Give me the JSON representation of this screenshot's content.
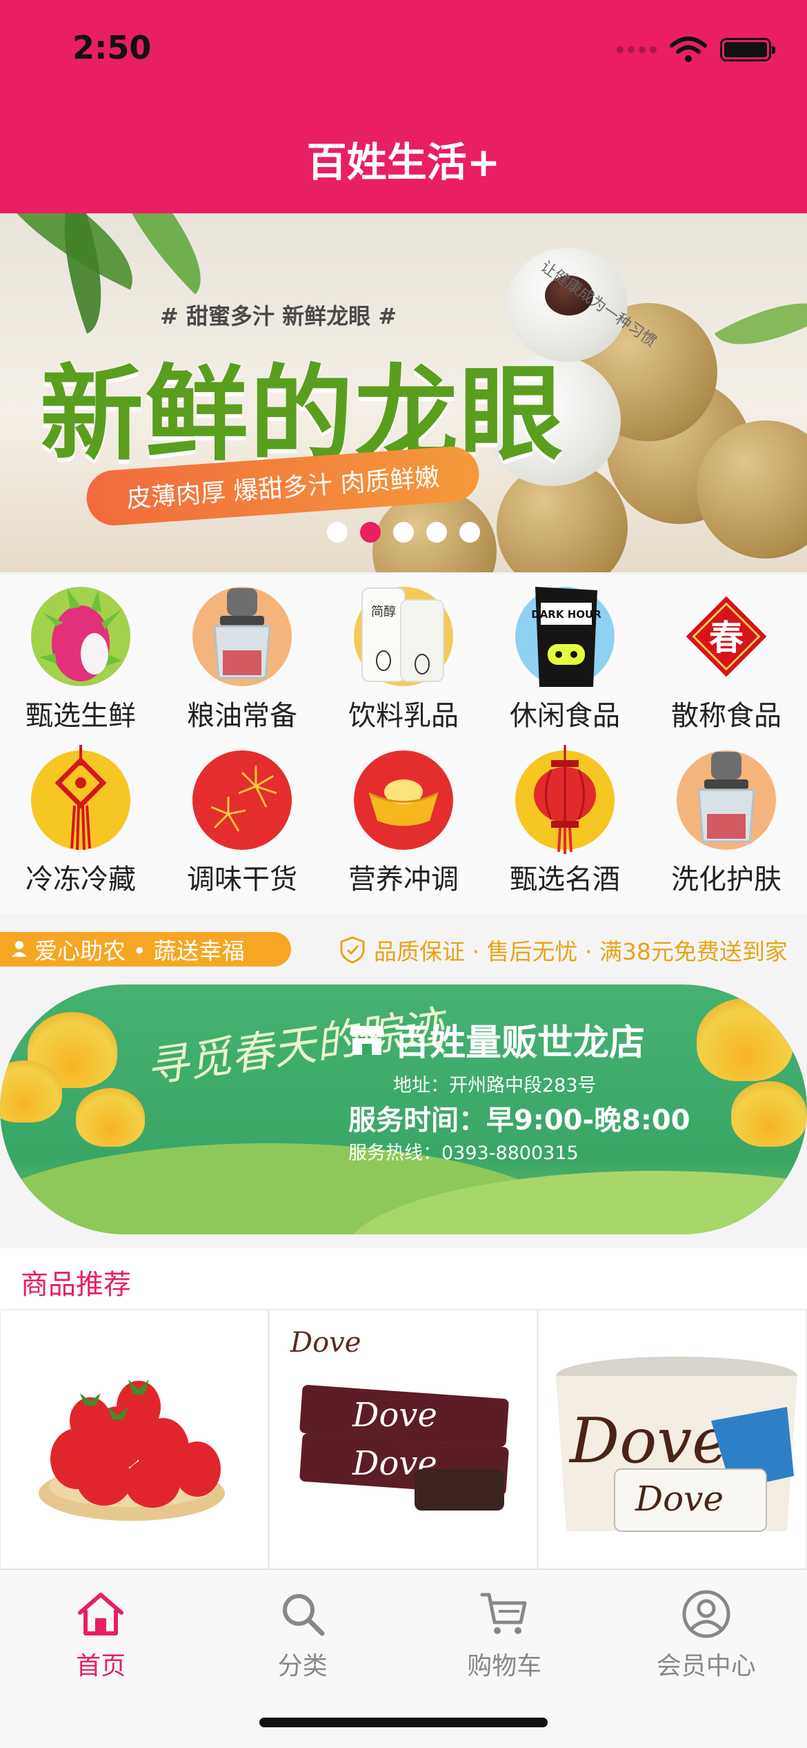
{
  "status_bar": {
    "time": "2:50"
  },
  "header": {
    "title": "百姓生活+"
  },
  "banner": {
    "tagline": "# 甜蜜多汁 新鲜龙眼 #",
    "side_text": "让健康成为一种习惯",
    "headline": "新鲜的龙眼",
    "pill": "皮薄肉厚 爆甜多汁 肉质鲜嫩",
    "slide_count": 5,
    "active_slide": 1
  },
  "categories": [
    {
      "label": "甄选生鲜",
      "icon": "dragonfruit-icon"
    },
    {
      "label": "粮油常备",
      "icon": "chopper-icon"
    },
    {
      "label": "饮料乳品",
      "icon": "milk-icon"
    },
    {
      "label": "休闲食品",
      "icon": "chips-icon"
    },
    {
      "label": "散称食品",
      "icon": "spring-icon"
    },
    {
      "label": "冷冻冷藏",
      "icon": "chinese-knot-icon"
    },
    {
      "label": "调味干货",
      "icon": "fireworks-icon"
    },
    {
      "label": "营养冲调",
      "icon": "gold-ingot-icon"
    },
    {
      "label": "甄选名酒",
      "icon": "lantern-icon"
    },
    {
      "label": "洗化护肤",
      "icon": "chopper-icon"
    }
  ],
  "notice": {
    "left": "爱心助农 • 蔬送幸福",
    "right": "品质保证 · 售后无忧 · 满38元免费送到家"
  },
  "store": {
    "slogan": "寻觅春天的踪迹",
    "name": "百姓量贩世龙店",
    "address": "地址：开州路中段283号",
    "hours": "服务时间：早9:00-晚8:00",
    "phone": "服务热线：0393-8800315"
  },
  "recommend": {
    "title": "商品推荐",
    "products": [
      {
        "name": "strawberries"
      },
      {
        "name": "dove-chocolate-bars",
        "brand": "Dove"
      },
      {
        "name": "dove-chocolate-tub",
        "brand": "Dove"
      }
    ]
  },
  "tabbar": {
    "tabs": [
      {
        "label": "首页",
        "icon": "home-icon",
        "active": true
      },
      {
        "label": "分类",
        "icon": "search-icon",
        "active": false
      },
      {
        "label": "购物车",
        "icon": "cart-icon",
        "active": false
      },
      {
        "label": "会员中心",
        "icon": "user-icon",
        "active": false
      }
    ]
  },
  "colors": {
    "brand": "#e91e63",
    "notice": "#f6a623",
    "store_green": "#3aa666"
  }
}
